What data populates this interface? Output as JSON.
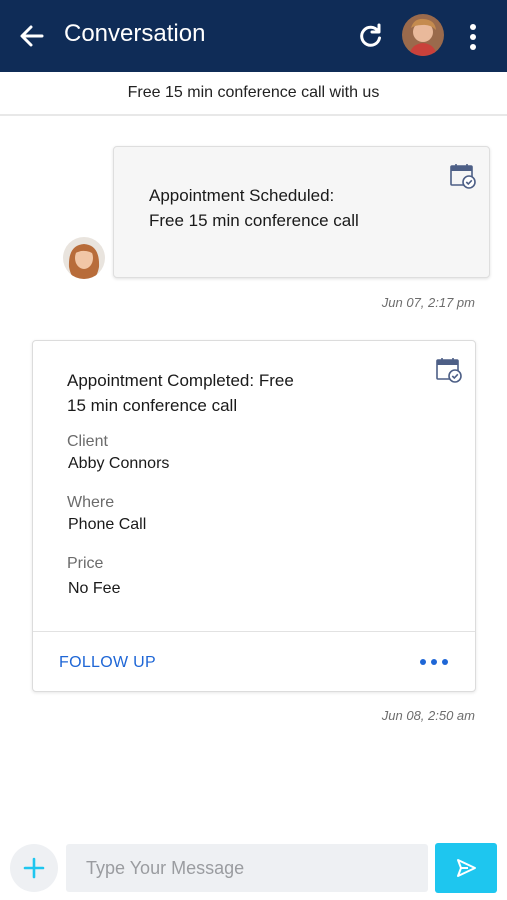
{
  "header": {
    "title": "Conversation",
    "back_icon": "back-arrow-icon",
    "refresh_icon": "refresh-icon",
    "menu_icon": "more-vertical-icon",
    "background_color": "#0f2c57"
  },
  "subheader": {
    "text": "Free 15 min conference call with us"
  },
  "messages": [
    {
      "type": "appointment-scheduled",
      "title_line1": "Appointment Scheduled:",
      "title_line2": "Free 15 min conference call",
      "icon": "calendar-check-icon",
      "timestamp": "Jun 07, 2:17 pm"
    },
    {
      "type": "appointment-completed",
      "title_line1": "Appointment Completed:  Free",
      "title_line2": "15 min conference call",
      "icon": "calendar-check-icon",
      "client_label": "Client",
      "client_value": "Abby Connors",
      "where_label": "Where",
      "where_value": "Phone Call",
      "price_label": "Price",
      "price_value": "No Fee",
      "action_label": "FOLLOW UP",
      "more_icon": "more-horizontal-icon",
      "timestamp": "Jun 08, 2:50 am"
    }
  ],
  "composer": {
    "add_icon": "plus-icon",
    "placeholder": "Type Your Message",
    "value": "",
    "send_icon": "send-icon",
    "accent_color": "#1ec6ef"
  }
}
